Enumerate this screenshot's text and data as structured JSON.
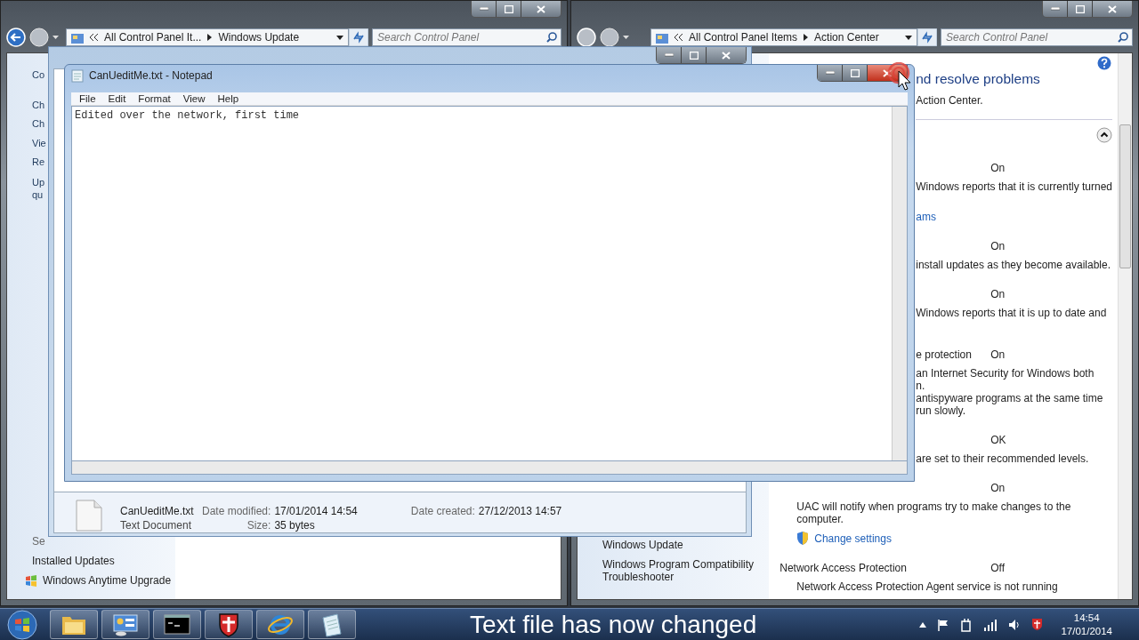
{
  "windows_update_window": {
    "breadcrumb": [
      "All Control Panel It...",
      "Windows Update"
    ],
    "search_placeholder": "Search Control Panel",
    "sidebar_lines": [
      "Co",
      "Ch",
      "Ch",
      "Vie",
      "Re",
      "Up qu"
    ],
    "see_also_heading": "Se",
    "see_also_links": [
      {
        "text": "Installed Updates",
        "kind": "plain"
      },
      {
        "text": "Windows Anytime Upgrade",
        "kind": "flag"
      }
    ]
  },
  "action_center_window": {
    "breadcrumb": [
      "All Control Panel Items",
      "Action Center"
    ],
    "search_placeholder": "Search Control Panel",
    "heading": "nd resolve problems",
    "intro": "Action Center.",
    "partly_hidden_rows": [
      {
        "kind": "status",
        "value": "On"
      },
      {
        "kind": "text",
        "text": "Windows reports that it is currently turned"
      },
      {
        "kind": "link",
        "text": "ams"
      },
      {
        "kind": "status",
        "value": "On"
      },
      {
        "kind": "text",
        "text": "install updates as they become available."
      },
      {
        "kind": "status",
        "value": "On"
      },
      {
        "kind": "text",
        "text": "Windows reports that it is up to date and"
      },
      {
        "kind": "status",
        "label": "e protection",
        "value": "On"
      },
      {
        "kind": "text",
        "text": "an Internet Security for Windows both"
      },
      {
        "kind": "text",
        "text": "n."
      },
      {
        "kind": "text",
        "text": "antispyware programs at the same time"
      },
      {
        "kind": "text",
        "text": "run slowly."
      },
      {
        "kind": "status",
        "value": "OK"
      },
      {
        "kind": "text",
        "text": "are set to their recommended levels."
      }
    ],
    "rows": [
      {
        "kind": "status",
        "value": "On"
      },
      {
        "kind": "text",
        "text": "UAC will notify when programs try to make changes to the computer."
      },
      {
        "kind": "shield_link",
        "text": "Change settings"
      },
      {
        "kind": "status",
        "label": "Network Access Protection",
        "value": "Off"
      },
      {
        "kind": "text",
        "text": "Network Access Protection Agent service is not running"
      }
    ],
    "see_also_links": [
      "Windows Update",
      "Windows Program Compatibility Troubleshooter"
    ]
  },
  "documents_window": {
    "file": {
      "name": "CanUeditMe.txt",
      "type": "Text Document",
      "date_modified_label": "Date modified:",
      "date_modified": "17/01/2014 14:54",
      "date_created_label": "Date created:",
      "date_created": "27/12/2013 14:57",
      "size_label": "Size:",
      "size": "35 bytes"
    }
  },
  "notepad_window": {
    "title": "CanUeditMe.txt - Notepad",
    "menu": [
      "File",
      "Edit",
      "Format",
      "View",
      "Help"
    ],
    "text": "Edited over the network, first time",
    "close_hovered": true
  },
  "taskbar": {
    "pinned": [
      {
        "kind": "folder"
      },
      {
        "kind": "control_panel"
      },
      {
        "kind": "console"
      },
      {
        "kind": "shield"
      },
      {
        "kind": "browser"
      },
      {
        "kind": "notepad"
      }
    ],
    "caption": "Text file has now changed",
    "clock": {
      "time": "14:54",
      "date": "17/01/2014"
    }
  }
}
